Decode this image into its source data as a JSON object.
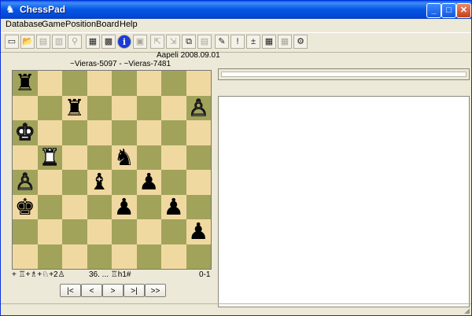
{
  "window": {
    "title": "ChessPad",
    "minimize_label": "_",
    "maximize_label": "□",
    "close_label": "✕"
  },
  "menu": [
    "Database",
    "Game",
    "Position",
    "Board",
    "Help"
  ],
  "toolbar": [
    {
      "name": "new",
      "glyph": "▭",
      "enabled": true
    },
    {
      "name": "open",
      "glyph": "📂",
      "enabled": true
    },
    {
      "name": "open-db",
      "glyph": "▤",
      "enabled": false
    },
    {
      "name": "db-list",
      "glyph": "▥",
      "enabled": false
    },
    {
      "name": "binoculars",
      "glyph": "⚲",
      "enabled": false
    },
    {
      "name": "new-game",
      "glyph": "▦",
      "enabled": true
    },
    {
      "name": "board-setup",
      "glyph": "▩",
      "enabled": true
    },
    {
      "name": "info",
      "glyph": "i",
      "enabled": true
    },
    {
      "name": "save",
      "glyph": "▣",
      "enabled": false
    },
    {
      "name": "export",
      "glyph": "⇱",
      "enabled": false
    },
    {
      "name": "import",
      "glyph": "⇲",
      "enabled": false
    },
    {
      "name": "copy",
      "glyph": "⧉",
      "enabled": true
    },
    {
      "name": "paste",
      "glyph": "▤",
      "enabled": false
    },
    {
      "name": "comment",
      "glyph": "✎",
      "enabled": true
    },
    {
      "name": "exclaim",
      "glyph": "!",
      "enabled": true
    },
    {
      "name": "plusminus",
      "glyph": "±",
      "enabled": true
    },
    {
      "name": "board-grid",
      "glyph": "▦",
      "enabled": true
    },
    {
      "name": "board-grid-2",
      "glyph": "▦",
      "enabled": false
    },
    {
      "name": "engine",
      "glyph": "⚙",
      "enabled": true
    }
  ],
  "game": {
    "event_date": "Aapeli 2008.09.01",
    "players": "~Vieras-5097 - ~Vieras-7481",
    "material": "+ ♖+♗+♘+2♙",
    "last_move": "36. ... ♖h1#",
    "result": "0-1"
  },
  "board": {
    "light_color": "#f0d9a0",
    "dark_color": "#a2a35b",
    "pieces": [
      {
        "square": "a8",
        "glyph": "♜",
        "color": "b"
      },
      {
        "square": "c7",
        "glyph": "♜",
        "color": "b"
      },
      {
        "square": "h7",
        "glyph": "♙",
        "color": "w"
      },
      {
        "square": "a6",
        "glyph": "♚",
        "color": "w"
      },
      {
        "square": "b5",
        "glyph": "♜",
        "color": "w"
      },
      {
        "square": "e5",
        "glyph": "♞",
        "color": "b"
      },
      {
        "square": "a4",
        "glyph": "♙",
        "color": "w"
      },
      {
        "square": "d4",
        "glyph": "♝",
        "color": "b"
      },
      {
        "square": "f4",
        "glyph": "♟",
        "color": "b"
      },
      {
        "square": "a3",
        "glyph": "♚",
        "color": "b"
      },
      {
        "square": "e3",
        "glyph": "♟",
        "color": "b"
      },
      {
        "square": "g3",
        "glyph": "♟",
        "color": "b"
      },
      {
        "square": "h2",
        "glyph": "♟",
        "color": "b"
      }
    ]
  },
  "nav": [
    "|<",
    "<",
    ">",
    ">|",
    ">>"
  ]
}
